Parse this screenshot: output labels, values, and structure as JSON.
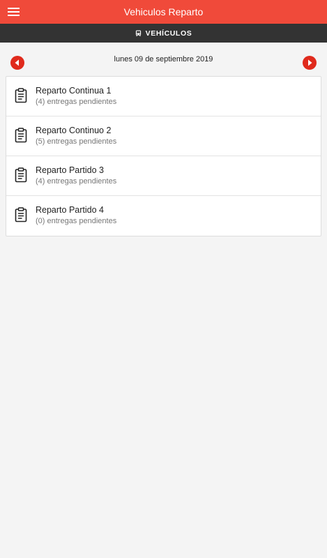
{
  "header": {
    "title": "Vehiculos Reparto",
    "menu_icon": "hamburger-menu-icon",
    "background_color": "#f04a3a"
  },
  "section": {
    "icon": "bus-icon",
    "title": "VEHÍCULOS",
    "background_color": "#333333"
  },
  "date_nav": {
    "date": "lunes 09 de septiembre 2019",
    "prev_icon": "arrow-left-circle-icon",
    "next_icon": "arrow-right-circle-icon",
    "accent_color": "#e02a1c"
  },
  "vehicles": [
    {
      "name": "Reparto Continua 1",
      "pending": "(4) entregas pendientes",
      "icon": "clipboard-icon"
    },
    {
      "name": "Reparto Continuo 2",
      "pending": "(5) entregas pendientes",
      "icon": "clipboard-icon"
    },
    {
      "name": "Reparto Partido 3",
      "pending": "(4) entregas pendientes",
      "icon": "clipboard-icon"
    },
    {
      "name": "Reparto Partido 4",
      "pending": "(0) entregas pendientes",
      "icon": "clipboard-icon"
    }
  ]
}
